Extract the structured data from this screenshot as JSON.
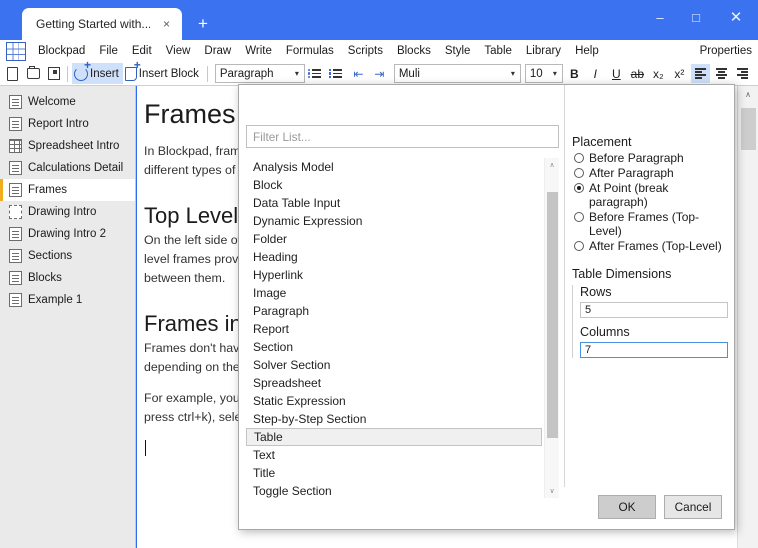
{
  "window": {
    "tab_title": "Getting Started with...",
    "close_tab_icon": "×",
    "new_tab_icon": "+",
    "minimize_icon": "–",
    "maximize_icon": "□",
    "close_icon": "✕"
  },
  "menubar": {
    "logo": "blockpad-logo-icon",
    "items": [
      "Blockpad",
      "File",
      "Edit",
      "View",
      "Draw",
      "Write",
      "Formulas",
      "Scripts",
      "Blocks",
      "Style",
      "Table",
      "Library",
      "Help"
    ],
    "right_item": "Properties"
  },
  "toolbar": {
    "new_icon": "new-document-icon",
    "open_icon": "open-folder-icon",
    "save_icon": "save-icon",
    "insert_label": "Insert",
    "insert_block_label": "Insert Block",
    "paragraph_style": "Paragraph",
    "font_family": "Muli",
    "font_size": "10",
    "bold": "B",
    "italic": "I",
    "underline": "U",
    "strikethrough": "ab",
    "subscript": "x₂",
    "superscript": "x²",
    "dropdown_arrow": "▾"
  },
  "sidebar": {
    "items": [
      {
        "label": "Welcome",
        "icon": "document-icon",
        "selected": false
      },
      {
        "label": "Report Intro",
        "icon": "document-icon",
        "selected": false
      },
      {
        "label": "Spreadsheet Intro",
        "icon": "spreadsheet-icon",
        "selected": false
      },
      {
        "label": "Calculations Detail",
        "icon": "document-icon",
        "selected": false
      },
      {
        "label": "Frames",
        "icon": "document-icon",
        "selected": true
      },
      {
        "label": "Drawing Intro",
        "icon": "drawing-icon",
        "selected": false
      },
      {
        "label": "Drawing Intro 2",
        "icon": "document-icon",
        "selected": false
      },
      {
        "label": "Sections",
        "icon": "document-icon",
        "selected": false
      },
      {
        "label": "Blocks",
        "icon": "document-icon",
        "selected": false
      },
      {
        "label": "Example 1",
        "icon": "document-icon",
        "selected": false
      }
    ]
  },
  "document": {
    "title": "Frames",
    "intro_line1": "In Blockpad, frame",
    "intro_line2": "different types of",
    "heading_top_level": "Top Level",
    "top_level_line1": "On the left side of",
    "top_level_line2": "level frames provi",
    "top_level_line3": "between them.",
    "heading_frames_in": "Frames in",
    "frames_in_line1": "Frames don't have",
    "frames_in_line2": "depending on the",
    "example_line1": "For example, you",
    "example_line2": "press ctrl+k), selec"
  },
  "dialog": {
    "filter_placeholder": "Filter List...",
    "filter_value": "",
    "list_items": [
      "Analysis Model",
      "Block",
      "Data Table Input",
      "Dynamic Expression",
      "Folder",
      "Heading",
      "Hyperlink",
      "Image",
      "Paragraph",
      "Report",
      "Section",
      "Solver Section",
      "Spreadsheet",
      "Static Expression",
      "Step-by-Step Section",
      "Table",
      "Text",
      "Title",
      "Toggle Section"
    ],
    "selected_item": "Table",
    "placement": {
      "title": "Placement",
      "options": [
        {
          "label": "Before Paragraph",
          "checked": false
        },
        {
          "label": "After Paragraph",
          "checked": false
        },
        {
          "label": "At Point (break paragraph)",
          "checked": true
        },
        {
          "label": "Before Frames (Top-Level)",
          "checked": false
        },
        {
          "label": "After Frames (Top-Level)",
          "checked": false
        }
      ]
    },
    "table_dimensions": {
      "title": "Table Dimensions",
      "rows_label": "Rows",
      "rows_value": "5",
      "columns_label": "Columns",
      "columns_value": "7"
    },
    "ok_label": "OK",
    "cancel_label": "Cancel",
    "scroll_up_icon": "∧",
    "scroll_down_icon": "∨"
  }
}
